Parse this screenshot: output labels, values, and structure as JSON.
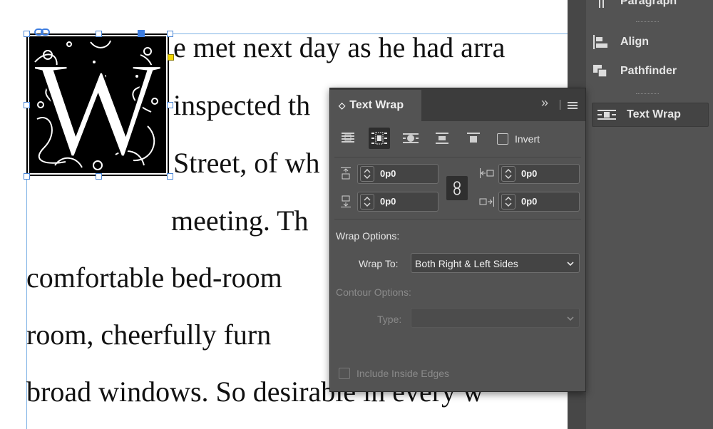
{
  "document": {
    "lines": [
      "e met next day as he had arra",
      "inspected th",
      "Street, of wh",
      "meeting. Th",
      "comfortable bed-room",
      "room, cheerfully furn",
      "broad windows. So desirable in every w"
    ],
    "dropcap_letter": "W"
  },
  "dock": {
    "items": [
      {
        "label": "Paragraph",
        "icon": "paragraph-icon"
      },
      {
        "label": "Align",
        "icon": "align-icon"
      },
      {
        "label": "Pathfinder",
        "icon": "pathfinder-icon"
      },
      {
        "label": "Text Wrap",
        "icon": "text-wrap-icon",
        "active": true
      }
    ]
  },
  "panel": {
    "tab_title": "Text Wrap",
    "tab_glyph": "◇",
    "menu_collapse": "»",
    "wrap_buttons": [
      {
        "name": "no-text-wrap",
        "selected": false
      },
      {
        "name": "wrap-around-bounding-box",
        "selected": true
      },
      {
        "name": "wrap-around-object-shape",
        "selected": false
      },
      {
        "name": "jump-object",
        "selected": false
      },
      {
        "name": "jump-to-next-column",
        "selected": false
      }
    ],
    "invert_label": "Invert",
    "invert_checked": false,
    "offsets": {
      "top": "0p0",
      "bottom": "0p0",
      "left": "0p0",
      "right": "0p0"
    },
    "wrap_options_label": "Wrap Options:",
    "wrap_to_label": "Wrap To:",
    "wrap_to_value": "Both Right & Left Sides",
    "contour_options_label": "Contour Options:",
    "type_label": "Type:",
    "type_value": "",
    "include_inside_edges_label": "Include Inside Edges",
    "include_inside_edges_checked": false
  },
  "colors": {
    "panel_bg": "#535353",
    "panel_header": "#3c3c3c",
    "selection_blue": "#4a86d6",
    "frame_edge": "#7fb2e5",
    "dropcap_bg": "#000000"
  }
}
